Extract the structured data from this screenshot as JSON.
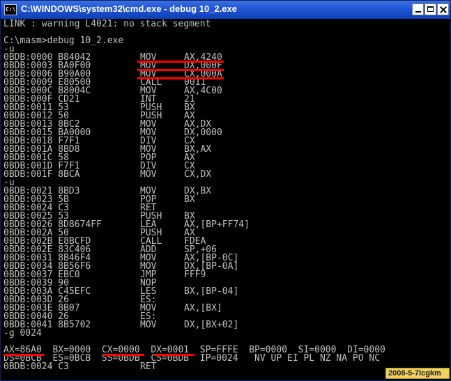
{
  "window": {
    "title": "C:\\WINDOWS\\system32\\cmd.exe - debug 10_2.exe",
    "icon": "console-icon",
    "icon_text": "C:\\"
  },
  "console": {
    "lines": [
      {
        "a": "LINK : warning L4021: no stack segment"
      },
      {
        "a": ""
      },
      {
        "a": "C:\\masm>debug 10_2.exe"
      },
      {
        "a": "-u"
      },
      {
        "a": "0BDB:0000 B84042",
        "b": "MOV",
        "c": "AX,4240"
      },
      {
        "a": "0BDB:0003 BA0F00",
        "b": "MOV",
        "c": "DX,000F"
      },
      {
        "a": "0BDB:0006 B90A00",
        "b": "MOV",
        "c": "CX,000A"
      },
      {
        "a": "0BDB:0009 E80500",
        "b": "CALL",
        "c": "0011"
      },
      {
        "a": "0BDB:000C B8004C",
        "b": "MOV",
        "c": "AX,4C00"
      },
      {
        "a": "0BDB:000F CD21",
        "b": "INT",
        "c": "21"
      },
      {
        "a": "0BDB:0011 53",
        "b": "PUSH",
        "c": "BX"
      },
      {
        "a": "0BDB:0012 50",
        "b": "PUSH",
        "c": "AX"
      },
      {
        "a": "0BDB:0013 8BC2",
        "b": "MOV",
        "c": "AX,DX"
      },
      {
        "a": "0BDB:0015 BA0000",
        "b": "MOV",
        "c": "DX,0000"
      },
      {
        "a": "0BDB:0018 F7F1",
        "b": "DIV",
        "c": "CX"
      },
      {
        "a": "0BDB:001A 8BD8",
        "b": "MOV",
        "c": "BX,AX"
      },
      {
        "a": "0BDB:001C 58",
        "b": "POP",
        "c": "AX"
      },
      {
        "a": "0BDB:001D F7F1",
        "b": "DIV",
        "c": "CX"
      },
      {
        "a": "0BDB:001F 8BCA",
        "b": "MOV",
        "c": "CX,DX"
      },
      {
        "a": "-u"
      },
      {
        "a": "0BDB:0021 8BD3",
        "b": "MOV",
        "c": "DX,BX"
      },
      {
        "a": "0BDB:0023 5B",
        "b": "POP",
        "c": "BX"
      },
      {
        "a": "0BDB:0024 C3",
        "b": "RET",
        "c": ""
      },
      {
        "a": "0BDB:0025 53",
        "b": "PUSH",
        "c": "BX"
      },
      {
        "a": "0BDB:0026 8D8674FF",
        "b": "LEA",
        "c": "AX,[BP+FF74]"
      },
      {
        "a": "0BDB:002A 50",
        "b": "PUSH",
        "c": "AX"
      },
      {
        "a": "0BDB:002B E8BCFD",
        "b": "CALL",
        "c": "FDEA"
      },
      {
        "a": "0BDB:002E 83C406",
        "b": "ADD",
        "c": "SP,+06"
      },
      {
        "a": "0BDB:0031 8B46F4",
        "b": "MOV",
        "c": "AX,[BP-0C]"
      },
      {
        "a": "0BDB:0034 8B56F6",
        "b": "MOV",
        "c": "DX,[BP-0A]"
      },
      {
        "a": "0BDB:0037 EBC0",
        "b": "JMP",
        "c": "FFF9"
      },
      {
        "a": "0BDB:0039 90",
        "b": "NOP",
        "c": ""
      },
      {
        "a": "0BDB:003A C45EFC",
        "b": "LES",
        "c": "BX,[BP-04]"
      },
      {
        "a": "0BDB:003D 26",
        "b": "ES:",
        "c": ""
      },
      {
        "a": "0BDB:003E 8B07",
        "b": "MOV",
        "c": "AX,[BX]"
      },
      {
        "a": "0BDB:0040 26",
        "b": "ES:",
        "c": ""
      },
      {
        "a": "0BDB:0041 8B5702",
        "b": "MOV",
        "c": "DX,[BX+02]"
      },
      {
        "a": "-g 0024"
      },
      {
        "a": ""
      },
      {
        "a": "AX=86A0  BX=0000  CX=0000  DX=0001  SP=FFFE  BP=0000  SI=0000  DI=0000"
      },
      {
        "a": "DS=0BCB  ES=0BCB  SS=0BDB  CS=0BDB  IP=0024   NV UP EI PL NZ NA PO NC"
      },
      {
        "a": "0BDB:0024 C3",
        "b": "RET",
        "c": ""
      }
    ],
    "highlight_color": "#ff0000",
    "text_color": "#c0c0c0",
    "background": "#000000"
  },
  "watermark": {
    "text": "2008-5-7lcgkm",
    "color": "#f0d060"
  }
}
